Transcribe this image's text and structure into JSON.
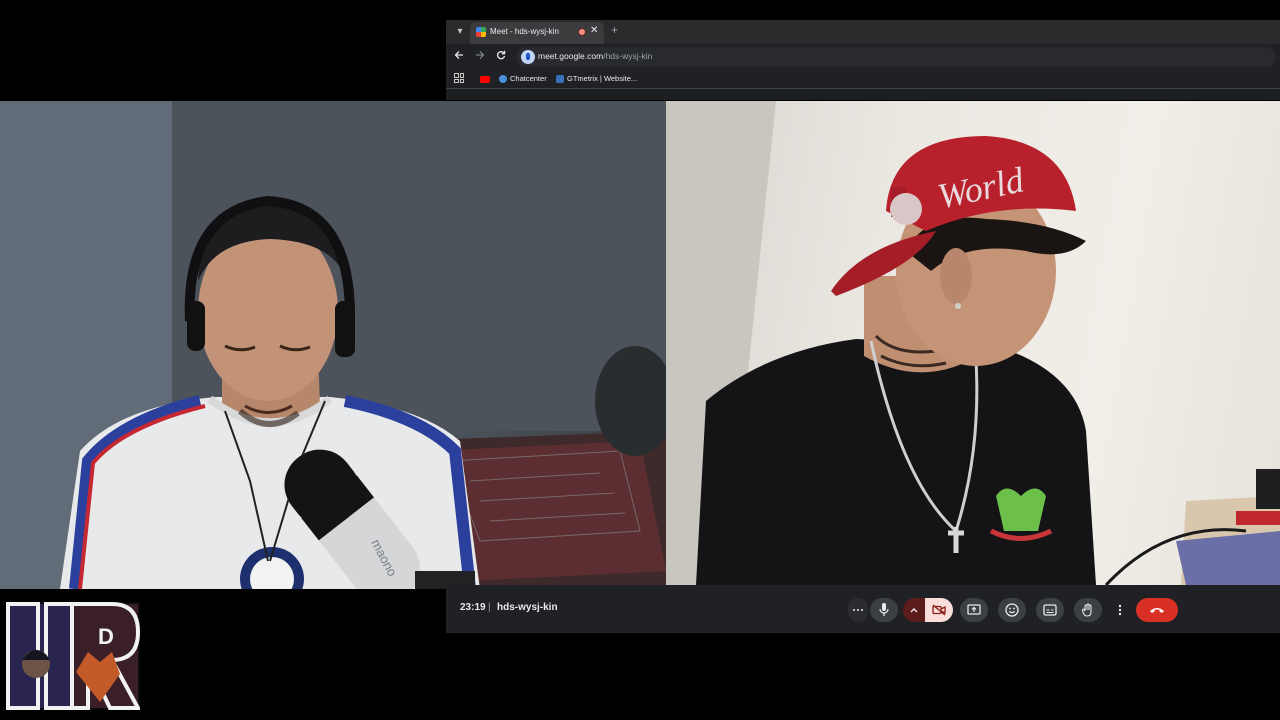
{
  "browser": {
    "tab": {
      "title": "Meet - hds-wysj-kin"
    },
    "new_tab_symbol": "+",
    "url_host": "meet.google.com",
    "url_path": "/hds-wysj-kin",
    "bookmarks": [
      {
        "label": "Chatcenter",
        "icon": "chatcenter-icon",
        "color": "#4a90d9"
      },
      {
        "label": "GTmetrix | Website...",
        "icon": "gtmetrix-icon",
        "color": "#3b6fb6"
      }
    ]
  },
  "meet": {
    "time": "23:19",
    "separator": "|",
    "meeting_code": "hds-wysj-kin",
    "controls": [
      "more-options-icon",
      "microphone-icon",
      "chevron-up-icon",
      "camera-off-icon",
      "present-screen-icon",
      "emoji-icon",
      "captions-icon",
      "raise-hand-icon",
      "more-vert-icon",
      "leave-call-icon"
    ],
    "colors": {
      "leave": "#d93025",
      "camera_off_bg": "#f9dedc",
      "camera_off_icon": "#8c1d18",
      "chevron_bg": "#5c1c1c"
    }
  },
  "left_video": {
    "microphone_brand": "maono"
  },
  "right_video": {
    "cap_text": "World"
  },
  "logo": {
    "letters": "HDR"
  }
}
